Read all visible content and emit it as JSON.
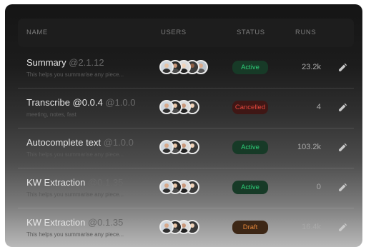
{
  "table": {
    "columns": {
      "name": "NAME",
      "users": "USERS",
      "status": "STATUS",
      "runs": "RUNS"
    },
    "rows": [
      {
        "name": "Summary",
        "version": "@2.1.12",
        "description": "This helps you summarise any piece...",
        "status": "Active",
        "runs": "23.2k",
        "users": [
          "user-avatar",
          "user-avatar",
          "user-avatar",
          "user-avatar",
          "user-avatar"
        ]
      },
      {
        "name": "Transcribe",
        "version": "@0.0.4",
        "version2": "@1.0.0",
        "description": "meeting, notes, fast",
        "status": "Cancelled",
        "runs": "4",
        "users": [
          "user-avatar",
          "user-avatar",
          "user-avatar",
          "user-avatar"
        ]
      },
      {
        "name": "Autocomplete text",
        "version": "@1.0.0",
        "description": "This helps you summarise any piece...",
        "status": "Active",
        "runs": "103.2k",
        "users": [
          "user-avatar",
          "user-avatar",
          "user-avatar",
          "user-avatar"
        ]
      },
      {
        "name": "KW Extraction",
        "version": "@0.1.35",
        "description": "This helps you summarise any piece...",
        "status": "Active",
        "runs": "0",
        "users": [
          "user-avatar",
          "user-avatar",
          "user-avatar",
          "user-avatar"
        ]
      },
      {
        "name": "KW Extraction",
        "version": "@0.1.35",
        "description": "This helps you summarise any piece...",
        "status": "Draft",
        "runs": "16.4k",
        "users": [
          "user-avatar",
          "user-avatar",
          "user-avatar",
          "user-avatar"
        ]
      }
    ]
  },
  "status_colors": {
    "Active": {
      "text": "#2fd17a",
      "bg": "#173a27"
    },
    "Cancelled": {
      "text": "#e4473d",
      "bg": "#3f1715"
    },
    "Draft": {
      "text": "#e4863a",
      "bg": "#3d2716"
    }
  },
  "edit_icon": "pencil-icon"
}
